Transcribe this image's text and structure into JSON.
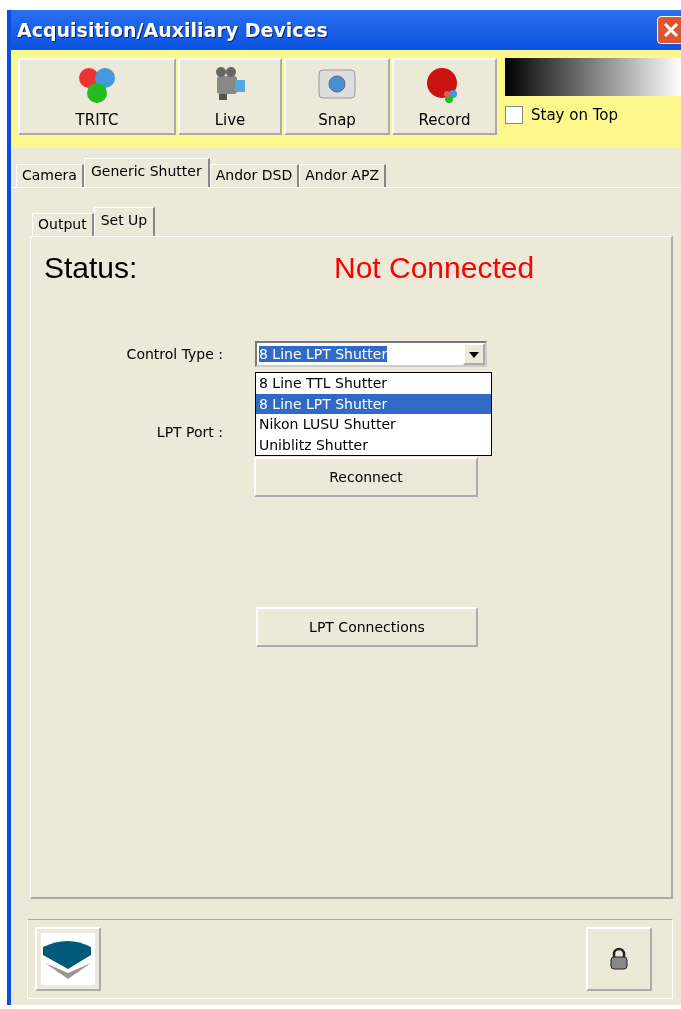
{
  "window": {
    "title": "Acquisition/Auxiliary Devices"
  },
  "toolbar": {
    "buttons": [
      {
        "label": "TRITC",
        "kind": "channels"
      },
      {
        "label": "Live",
        "kind": "camcorder"
      },
      {
        "label": "Snap",
        "kind": "camera"
      },
      {
        "label": "Record",
        "kind": "record"
      }
    ],
    "stay_on_top": {
      "label": "Stay on Top",
      "checked": false
    }
  },
  "tabs": [
    {
      "label": "Camera",
      "selected": false
    },
    {
      "label": "Generic Shutter",
      "selected": true
    },
    {
      "label": "Andor DSD",
      "selected": false
    },
    {
      "label": "Andor APZ",
      "selected": false
    }
  ],
  "subtabs": [
    {
      "label": "Output",
      "selected": false
    },
    {
      "label": "Set Up",
      "selected": true
    }
  ],
  "status": {
    "label": "Status:",
    "value": "Not Connected"
  },
  "control_type": {
    "label": "Control Type :",
    "value": "8 Line LPT Shutter",
    "options": [
      {
        "label": "8 Line TTL Shutter",
        "selected": false
      },
      {
        "label": "8 Line LPT Shutter",
        "selected": true
      },
      {
        "label": "Nikon LUSU Shutter",
        "selected": false
      },
      {
        "label": "Uniblitz Shutter",
        "selected": false
      }
    ]
  },
  "lpt_port": {
    "label": "LPT Port :"
  },
  "buttons": [
    "Reconnect",
    "LPT Connections"
  ]
}
